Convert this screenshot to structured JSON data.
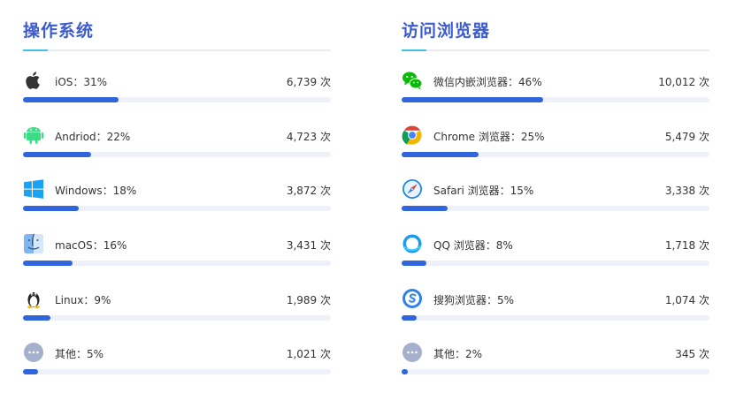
{
  "os": {
    "title": "操作系统",
    "items": [
      {
        "label": "iOS：31%",
        "count": "6,739 次",
        "percent": 31,
        "icon": "apple-icon"
      },
      {
        "label": "Andriod：22%",
        "count": "4,723 次",
        "percent": 22,
        "icon": "android-icon"
      },
      {
        "label": "Windows：18%",
        "count": "3,872 次",
        "percent": 18,
        "icon": "windows-icon"
      },
      {
        "label": "macOS：16%",
        "count": "3,431 次",
        "percent": 16,
        "icon": "macos-finder-icon"
      },
      {
        "label": "Linux：9%",
        "count": "1,989 次",
        "percent": 9,
        "icon": "linux-penguin-icon"
      },
      {
        "label": "其他：5%",
        "count": "1,021 次",
        "percent": 5,
        "icon": "more-icon"
      }
    ]
  },
  "browser": {
    "title": "访问浏览器",
    "items": [
      {
        "label": "微信内嵌浏览器：46%",
        "count": "10,012 次",
        "percent": 46,
        "icon": "wechat-icon"
      },
      {
        "label": "Chrome 浏览器：25%",
        "count": "5,479 次",
        "percent": 25,
        "icon": "chrome-icon"
      },
      {
        "label": "Safari 浏览器：15%",
        "count": "3,338 次",
        "percent": 15,
        "icon": "safari-icon"
      },
      {
        "label": "QQ 浏览器：8%",
        "count": "1,718 次",
        "percent": 8,
        "icon": "qq-browser-icon"
      },
      {
        "label": "搜狗浏览器：5%",
        "count": "1,074 次",
        "percent": 5,
        "icon": "sogou-icon"
      },
      {
        "label": "其他：2%",
        "count": "345 次",
        "percent": 2,
        "icon": "more-icon"
      }
    ]
  },
  "colors": {
    "title": "#3c5bd3",
    "accent": "#3fc2e6",
    "bar_fill": "#3165dc",
    "bar_track": "#eef1fa"
  }
}
